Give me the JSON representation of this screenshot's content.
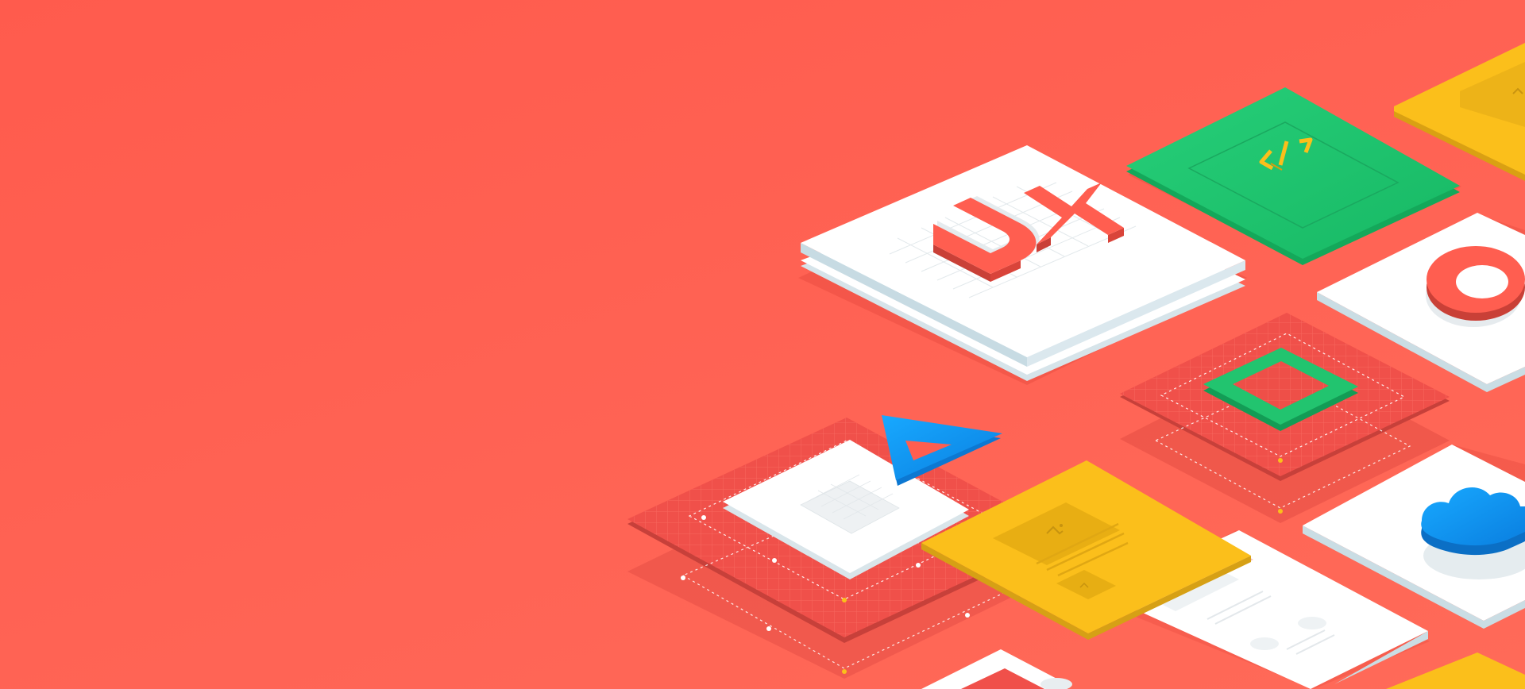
{
  "hero": {
    "background_color": "#ff5e50",
    "illustration": {
      "style": "isometric tiles",
      "ux_tile_text": "UX",
      "code_tile_glyph": "</>",
      "colors": {
        "coral": "#ff5e50",
        "red_grid": "#ec4a44",
        "white": "#ffffff",
        "tile_edge": "#cfe3ea",
        "green": "#1fc46f",
        "yellow": "#fbbf1b",
        "blue": "#129cf3",
        "cloud_blue": "#168df0"
      },
      "icons": [
        "code-icon",
        "ring-icon",
        "square-frame-icon",
        "triangle-icon",
        "cloud-icon",
        "image-placeholder-icon"
      ]
    }
  }
}
